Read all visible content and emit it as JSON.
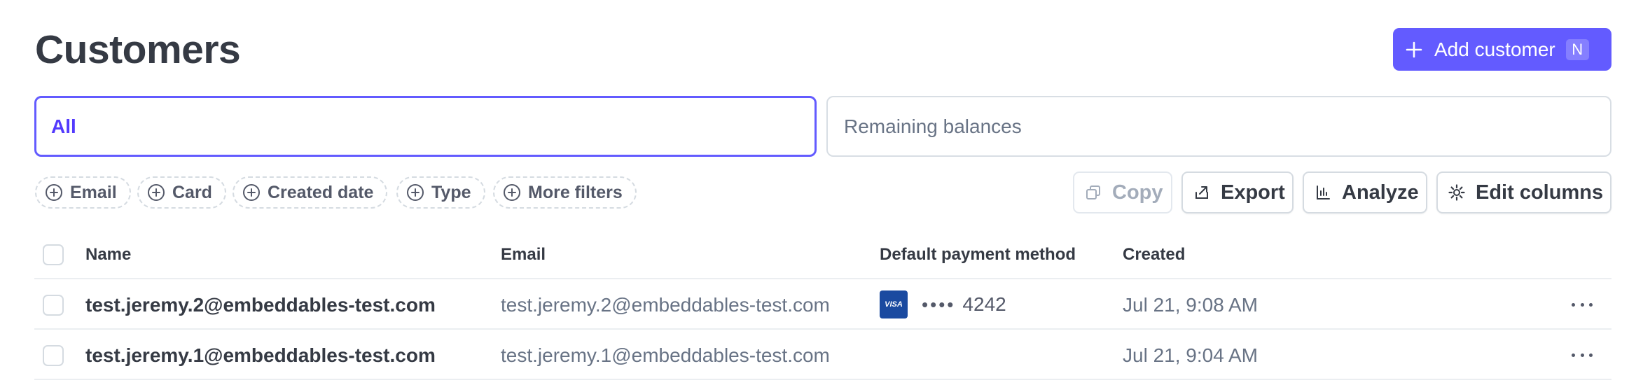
{
  "page": {
    "title": "Customers"
  },
  "add_button": {
    "label": "Add customer",
    "shortcut": "N"
  },
  "tabs": [
    {
      "label": "All",
      "active": true
    },
    {
      "label": "Remaining balances",
      "active": false
    }
  ],
  "filters": [
    {
      "label": "Email"
    },
    {
      "label": "Card"
    },
    {
      "label": "Created date"
    },
    {
      "label": "Type"
    },
    {
      "label": "More filters"
    }
  ],
  "toolbar": {
    "copy_label": "Copy",
    "export_label": "Export",
    "analyze_label": "Analyze",
    "edit_columns_label": "Edit columns"
  },
  "table": {
    "columns": [
      "Name",
      "Email",
      "Default payment method",
      "Created"
    ],
    "rows": [
      {
        "name": "test.jeremy.2@embeddables-test.com",
        "email": "test.jeremy.2@embeddables-test.com",
        "card_brand": "VISA",
        "card_dots": "••••",
        "card_last4": "4242",
        "created": "Jul 21, 9:08 AM"
      },
      {
        "name": "test.jeremy.1@embeddables-test.com",
        "email": "test.jeremy.1@embeddables-test.com",
        "card_brand": "",
        "card_dots": "",
        "card_last4": "",
        "created": "Jul 21, 9:04 AM"
      }
    ]
  },
  "colors": {
    "accent": "#635bff",
    "text": "#353a44",
    "muted": "#687385",
    "border": "#d5dbe1"
  },
  "icons": [
    "plus-icon",
    "plus-circle-icon",
    "copy-icon",
    "export-icon",
    "analyze-icon",
    "gear-icon",
    "more-icon"
  ]
}
